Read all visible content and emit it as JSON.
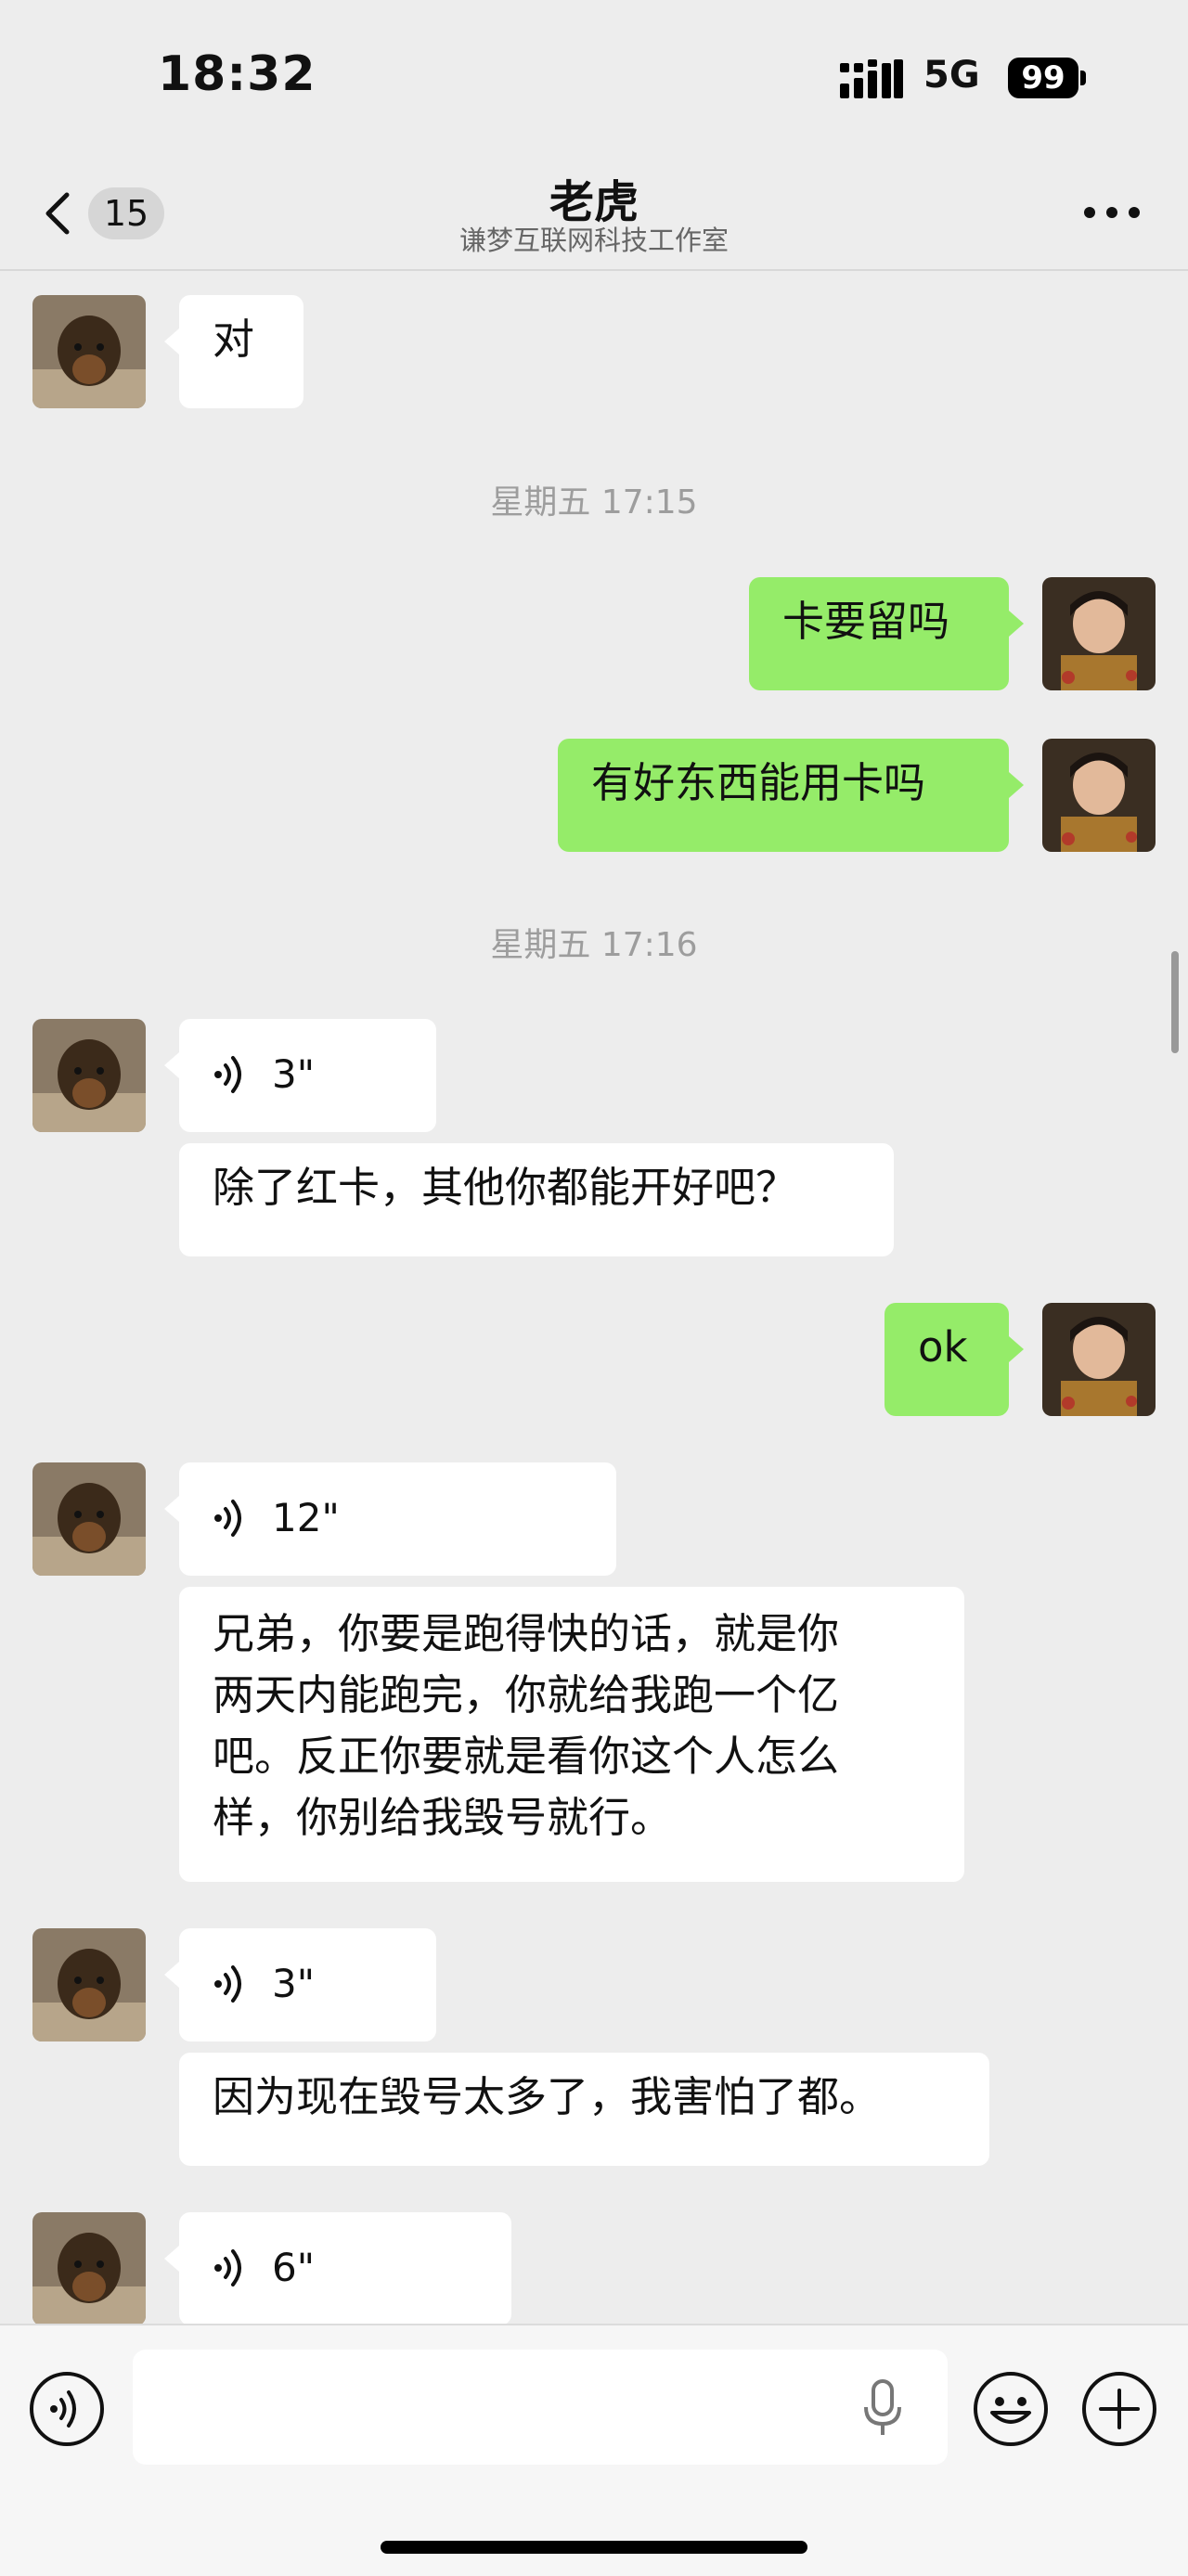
{
  "status_bar": {
    "time": "18:32",
    "network": "5G",
    "battery": "99"
  },
  "header": {
    "unread_count": "15",
    "title": "老虎",
    "subtitle": "谦梦互联网科技工作室"
  },
  "messages": {
    "m1": {
      "sender": "contact",
      "type": "text",
      "text": "对"
    },
    "ts1": "星期五 17:15",
    "m2": {
      "sender": "me",
      "type": "text",
      "text": "卡要留吗"
    },
    "m3": {
      "sender": "me",
      "type": "text",
      "text": "有好东西能用卡吗"
    },
    "ts2": "星期五 17:16",
    "m4": {
      "sender": "contact",
      "type": "voice",
      "duration": "3\""
    },
    "m5": {
      "sender": "contact",
      "type": "text",
      "text": "除了红卡，其他你都能开好吧？"
    },
    "m6": {
      "sender": "me",
      "type": "text",
      "text": "ok"
    },
    "m7": {
      "sender": "contact",
      "type": "voice",
      "duration": "12\""
    },
    "m8": {
      "sender": "contact",
      "type": "text",
      "lines": [
        "兄弟，你要是跑得快的话，就是你",
        "两天内能跑完，你就给我跑一个亿",
        "吧。反正你要就是看你这个人怎么",
        "样，你别给我毁号就行。"
      ]
    },
    "m9": {
      "sender": "contact",
      "type": "voice",
      "duration": "3\""
    },
    "m10": {
      "sender": "contact",
      "type": "text",
      "text": "因为现在毁号太多了，我害怕了都。"
    },
    "m11": {
      "sender": "contact",
      "type": "voice",
      "duration": "6\""
    }
  },
  "colors": {
    "background": "#ededed",
    "outgoing_bubble": "#95ec69",
    "incoming_bubble": "#ffffff",
    "timestamp": "#9d9d9d"
  },
  "icons": [
    "back-chevron-icon",
    "more-icon",
    "voice-wave-icon",
    "voice-mode-icon",
    "microphone-icon",
    "emoji-icon",
    "plus-icon"
  ]
}
